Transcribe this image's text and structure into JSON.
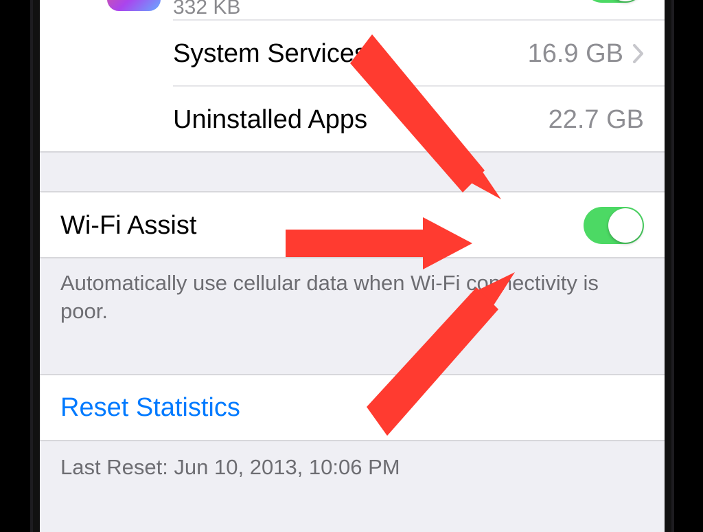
{
  "app_item": {
    "size_label": "332 KB"
  },
  "list": {
    "system_services": {
      "label": "System Services",
      "value": "16.9 GB"
    },
    "uninstalled": {
      "label": "Uninstalled Apps",
      "value": "22.7 GB"
    }
  },
  "wifi_assist": {
    "label": "Wi-Fi Assist",
    "enabled": true,
    "footer": "Automatically use cellular data when Wi-Fi connectivity is poor."
  },
  "reset": {
    "label": "Reset Statistics"
  },
  "last_reset": {
    "label": "Last Reset: Jun 10, 2013, 10:06 PM"
  },
  "colors": {
    "accent_green": "#4cd964",
    "link_blue": "#007aff",
    "arrow_red": "#ff3b30"
  }
}
